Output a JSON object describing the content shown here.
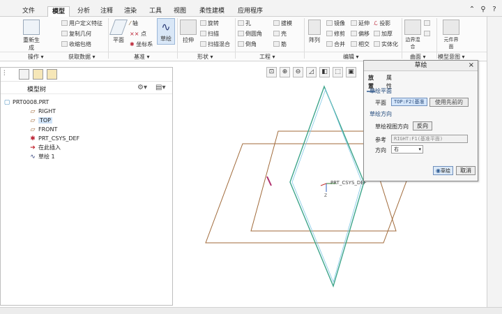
{
  "menu_tabs": [
    "文件",
    "模型",
    "分析",
    "注释",
    "渲染",
    "工具",
    "视图",
    "柔性建模",
    "应用程序"
  ],
  "active_tab": "模型",
  "ribbon": {
    "operations": {
      "regenerate": "重新生成",
      "items": [
        "用户定义特征",
        "复制几何",
        "收缩包络"
      ]
    },
    "datum": {
      "plane": "平面",
      "axis": "轴",
      "point": "点",
      "csys": "坐标系",
      "sketch": "草绘"
    },
    "shapes": {
      "extrude": "拉伸",
      "items": [
        "旋转",
        "扫描",
        "扫描混合"
      ]
    },
    "engineering": {
      "items": [
        "孔",
        "倒圆角",
        "倒角",
        "拔模",
        "壳",
        "筋"
      ]
    },
    "editing": {
      "pattern": "阵列",
      "items": [
        "镜像",
        "延伸",
        "投影",
        "修剪",
        "偏移",
        "加厚",
        "合并",
        "相交",
        "实体化"
      ]
    },
    "surface": {
      "boundary": "边界混合"
    },
    "model_intent": {
      "component_interface": "元件界面"
    },
    "groups": [
      "操作",
      "获取数据",
      "基准",
      "形状",
      "工程",
      "编辑",
      "曲面",
      "模型意图"
    ]
  },
  "model_tree": {
    "title": "模型树",
    "items": [
      {
        "label": "PRT0008.PRT",
        "icon": "part-icon"
      },
      {
        "label": "RIGHT",
        "icon": "datum-plane-icon"
      },
      {
        "label": "TOP",
        "icon": "datum-plane-icon",
        "highlighted": true
      },
      {
        "label": "FRONT",
        "icon": "datum-plane-icon"
      },
      {
        "label": "PRT_CSYS_DEF",
        "icon": "csys-icon"
      },
      {
        "label": "在此插入",
        "icon": "insert-arrow-icon"
      },
      {
        "label": "草绘 1",
        "icon": "sketch-icon"
      }
    ]
  },
  "viewport": {
    "csys_label": "PRT_CSYS_DEF"
  },
  "dialog": {
    "title": "草绘",
    "tabs": [
      "放置",
      "属性"
    ],
    "active_tab": "放置",
    "section_plane": "草绘平面",
    "plane_label": "平面",
    "plane_value": "TOP:F2(基准",
    "use_previous": "使用先前的",
    "section_orientation": "草绘方向",
    "view_direction_label": "草绘视图方向",
    "flip_button": "反向",
    "reference_label": "参考",
    "reference_value": "RIGHT:F1(基准平面)",
    "orientation_label": "方向",
    "orientation_value": "右",
    "ok": "草绘",
    "cancel": "取消"
  },
  "colors": {
    "accent": "#2f5c94",
    "plane_edge": "#a06a3a",
    "sketch_edge": "#3da58a"
  }
}
